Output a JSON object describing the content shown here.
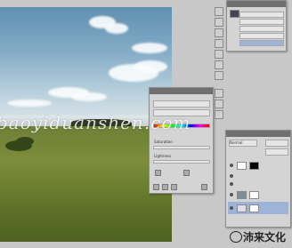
{
  "watermark": "baoyiduanshen.com",
  "logo_text": "沛来文化",
  "adjust_panel": {
    "title": "",
    "labels": [
      "Saturation",
      "Lightness"
    ]
  },
  "layers_panel": {
    "mode": "Normal",
    "opacity": "",
    "layers": [
      "",
      "",
      "",
      "",
      ""
    ]
  },
  "history_panel": {
    "items": [
      "",
      "",
      "",
      "",
      ""
    ]
  },
  "colors": {
    "workspace": "#c8c8c8",
    "panel": "#d4d4d4",
    "title_bar": "#6f6f6f"
  }
}
